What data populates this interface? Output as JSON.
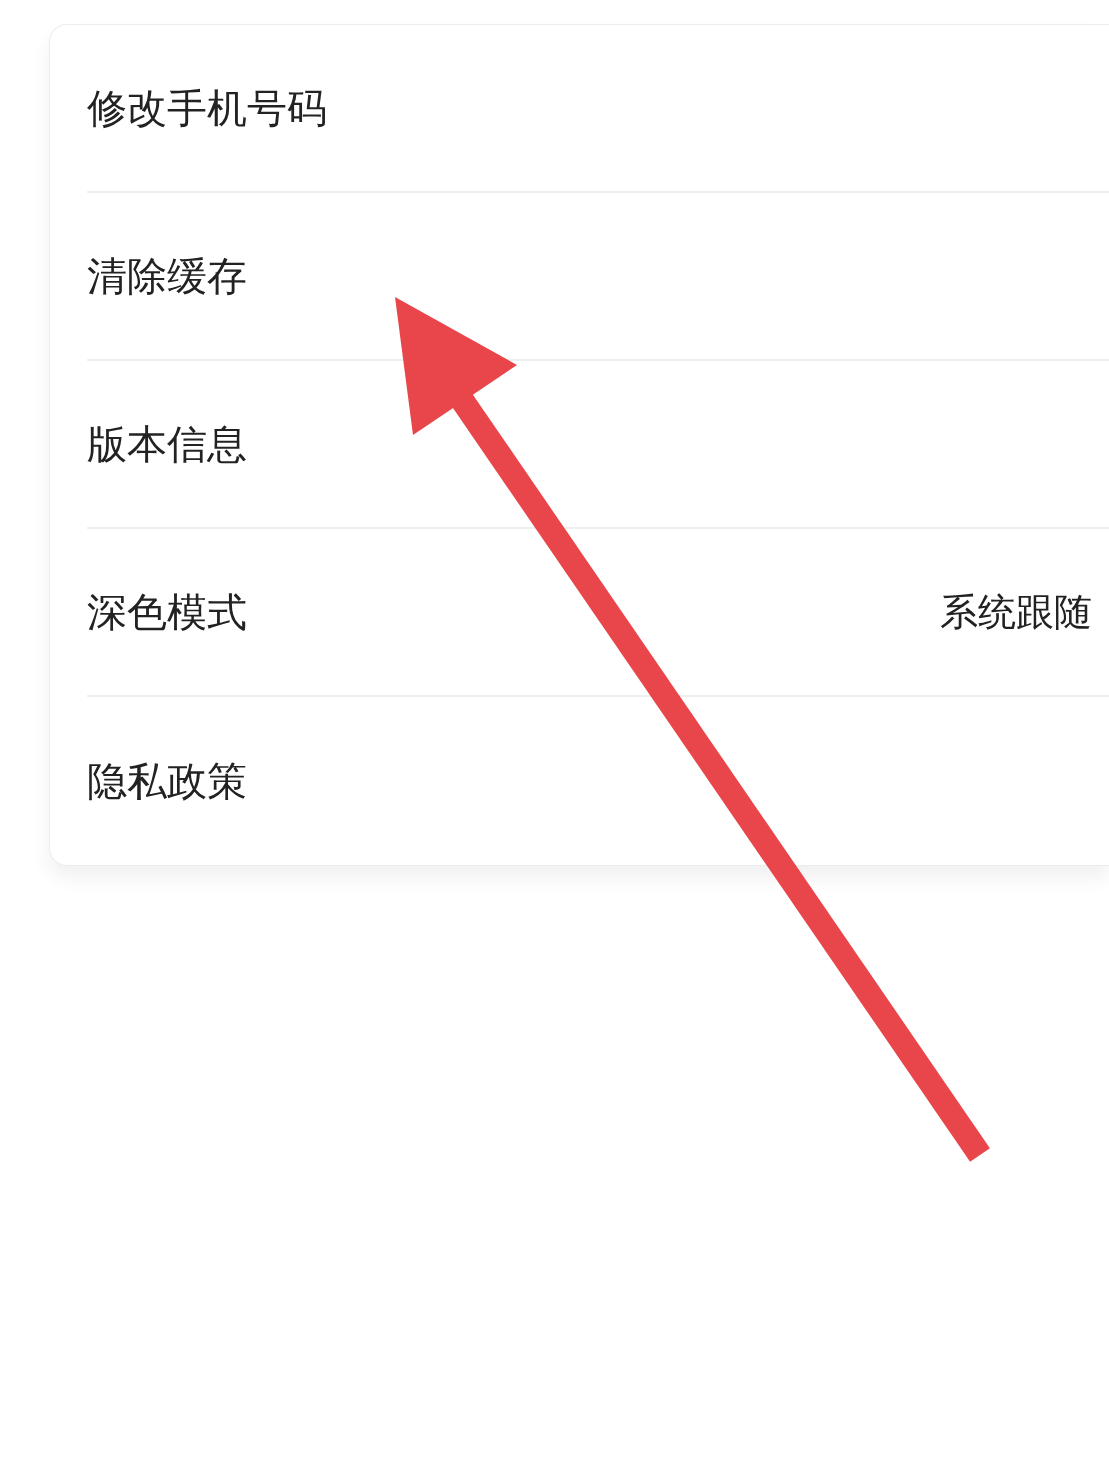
{
  "settings_list": [
    {
      "label": "修改手机号码"
    },
    {
      "label": "清除缓存"
    },
    {
      "label": "版本信息"
    },
    {
      "label": "深色模式",
      "value": "系统跟随"
    },
    {
      "label": "隐私政策"
    }
  ]
}
